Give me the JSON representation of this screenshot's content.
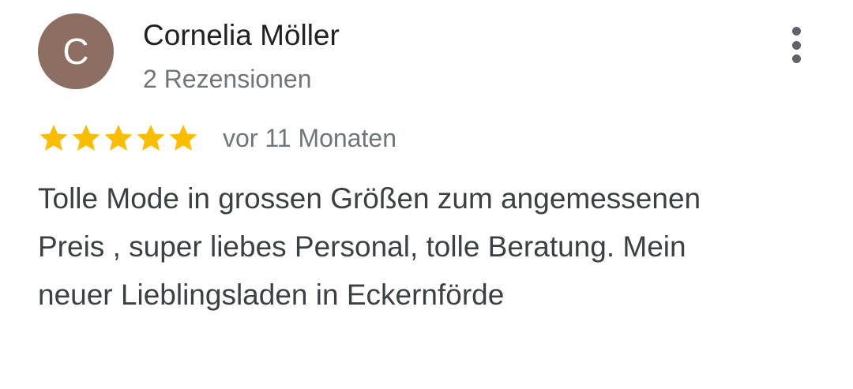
{
  "review": {
    "avatar_initial": "C",
    "avatar_color": "#8d6e63",
    "reviewer_name": "Cornelia Möller",
    "review_count": "2 Rezensionen",
    "rating": 5,
    "rating_max": 5,
    "star_color": "#fbbc04",
    "time_ago": "vor 11 Monaten",
    "text": "Tolle Mode in grossen Größen zum angemessenen Preis , super liebes Personal, tolle Beratung. Mein neuer Lieblingsladen in Eckernförde"
  },
  "icons": {
    "more": "more-vert-icon",
    "star": "star-icon"
  }
}
